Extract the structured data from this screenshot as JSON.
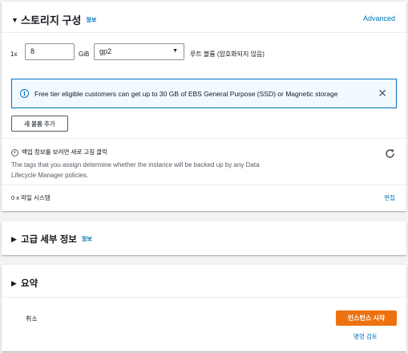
{
  "storage": {
    "title": "스토리지 구성",
    "info": "정보",
    "advanced": "Advanced",
    "count_label": "1x",
    "size_value": "8",
    "size_unit": "GiB",
    "volume_type": "gp2",
    "root_volume_label": "루트 볼륨",
    "encryption_note": "(암호화되지 않음)",
    "free_tier_alert": "Free tier eligible customers can get up to 30 GB of EBS General Purpose (SSD) or Magnetic storage",
    "add_volume_button": "새 볼륨 추가",
    "backup_heading": "백업 정보를 보려면 새로 고침 클릭",
    "backup_desc_line1": "The tags that you assign determine whether the instance will be backed up by any Data",
    "backup_desc_line2": "Lifecycle Manager policies.",
    "file_systems": "0 x 파일 시스템",
    "edit": "편집"
  },
  "advanced_details": {
    "title": "고급 세부 정보",
    "info": "정보"
  },
  "summary": {
    "title": "요약",
    "cancel": "취소",
    "launch_button": "인스턴스 시작",
    "review_commands": "명령 검토"
  },
  "icons": {
    "caret_down": "caret-down-icon",
    "caret_right": "caret-right-icon",
    "info": "info-circle-icon",
    "close": "close-icon",
    "clock": "clock-icon",
    "refresh": "refresh-icon",
    "dropdown": "chevron-down-icon"
  },
  "colors": {
    "link": "#0073bb",
    "primary_button": "#ec7211",
    "alert_bg": "#f1faff",
    "alert_border": "#0073bb"
  }
}
